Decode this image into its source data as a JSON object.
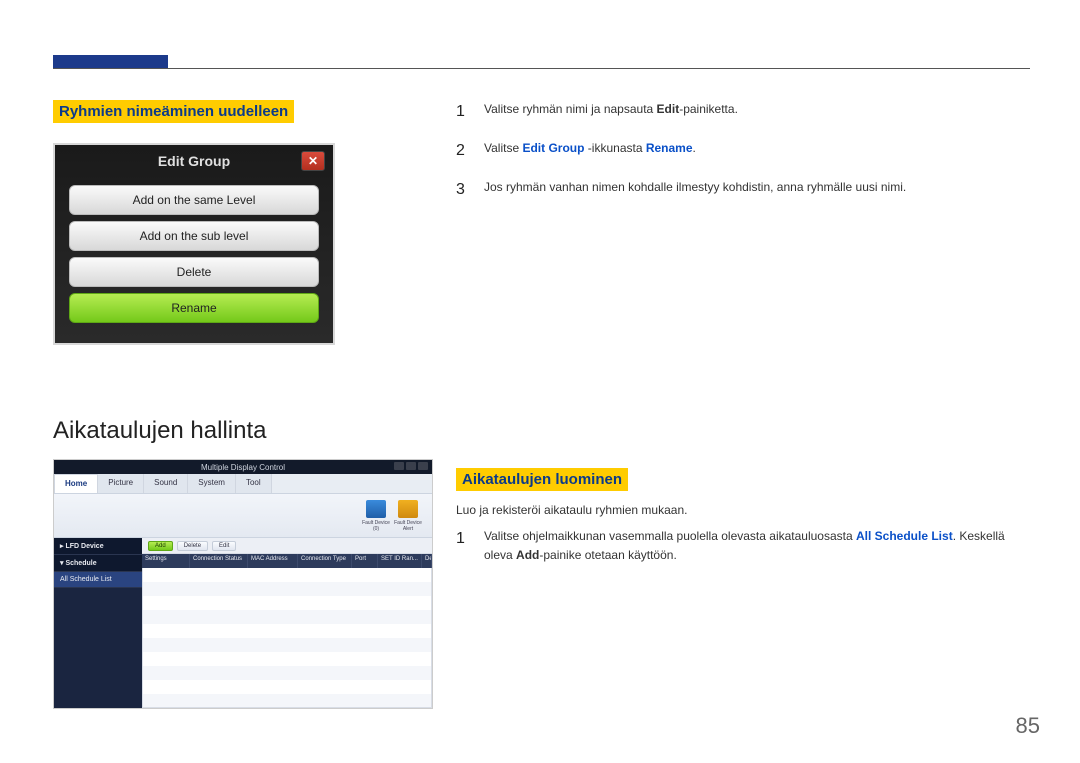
{
  "page_number": "85",
  "section1": {
    "heading": "Ryhmien nimeäminen uudelleen",
    "dialog": {
      "title": "Edit Group",
      "close_glyph": "✕",
      "buttons": [
        {
          "label": "Add on the same Level"
        },
        {
          "label": "Add on the sub level"
        },
        {
          "label": "Delete"
        },
        {
          "label": "Rename"
        }
      ]
    },
    "steps": {
      "s1": {
        "num": "1",
        "pre": "Valitse ryhmän nimi ja napsauta ",
        "kw": "Edit",
        "post": "-painiketta."
      },
      "s2": {
        "num": "2",
        "pre": "Valitse ",
        "kw1": "Edit Group",
        "mid": " -ikkunasta ",
        "kw2": "Rename",
        "post": "."
      },
      "s3": {
        "num": "3",
        "text": "Jos ryhmän vanhan nimen kohdalle ilmestyy kohdistin, anna ryhmälle uusi nimi."
      }
    }
  },
  "section2": {
    "heading": "Aikataulujen hallinta",
    "sub": "Aikataulujen luominen",
    "desc": "Luo ja rekisteröi aikataulu ryhmien mukaan.",
    "step1": {
      "num": "1",
      "pre": "Valitse ohjelmaikkunan vasemmalla puolella olevasta aikatauluosasta ",
      "kw1": "All Schedule List",
      "mid": ". Keskellä oleva ",
      "kw2": "Add",
      "post": "-painike otetaan käyttöön."
    },
    "app": {
      "title": "Multiple Display Control",
      "tabs": [
        "Home",
        "Picture",
        "Sound",
        "System",
        "Tool"
      ],
      "tool_icons": [
        {
          "name": "fault-device-icon",
          "label": "Fault Device (0)",
          "color1": "#3a8bdc",
          "color2": "#1f5ea8"
        },
        {
          "name": "fault-alert-icon",
          "label": "Fault Device Alert",
          "color1": "#f0b020",
          "color2": "#d08a10"
        }
      ],
      "sidebar": {
        "header1": "LFD Device",
        "header2": "Schedule",
        "item": "All Schedule List"
      },
      "crud": {
        "add": "Add",
        "delete": "Delete",
        "edit": "Edit"
      },
      "grid_headers": [
        "Settings",
        "Connection Status",
        "MAC Address",
        "Connection Type",
        "Port",
        "SET ID Ran...",
        "Detected Devices"
      ]
    }
  }
}
